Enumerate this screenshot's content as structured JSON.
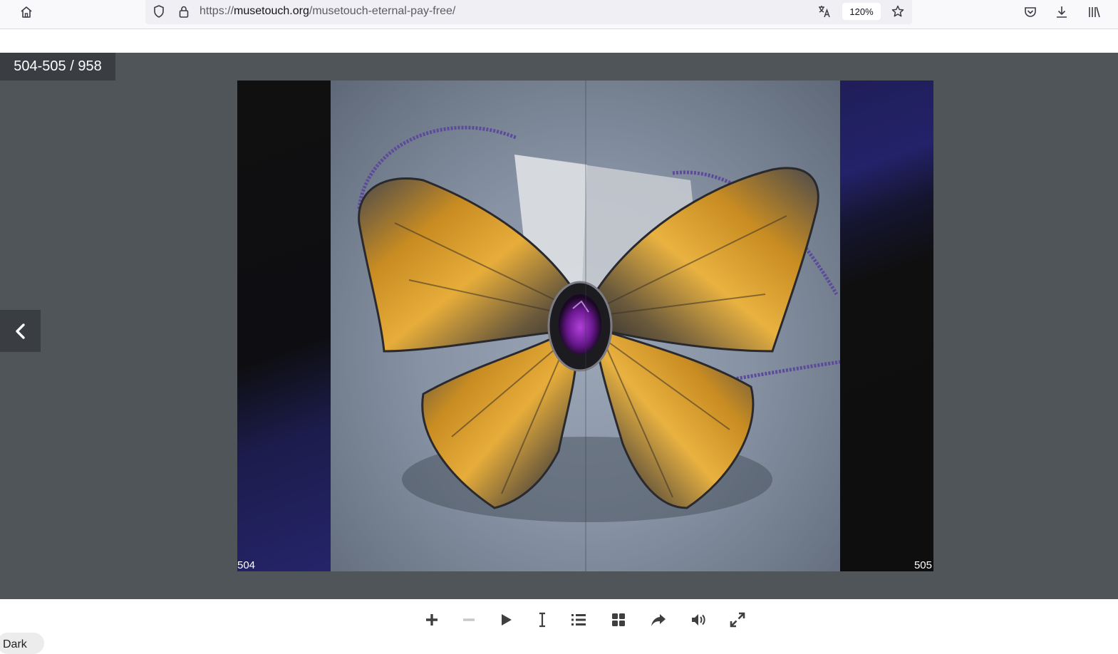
{
  "browser": {
    "url_scheme": "https://",
    "url_host": "musetouch.org",
    "url_path": "/musetouch-eternal-pay-free/",
    "zoom": "120%",
    "icons": [
      "home-icon",
      "shield-icon",
      "lock-icon",
      "translate-icon",
      "star-icon",
      "pocket-icon",
      "download-icon",
      "library-icon"
    ]
  },
  "viewer": {
    "page_counter": "504-505 / 958",
    "left_page_number": "504",
    "right_page_number": "505",
    "background_color": "#50555a"
  },
  "controls": {
    "icons": [
      "zoom-in-icon",
      "zoom-out-icon",
      "play-icon",
      "text-select-icon",
      "table-of-contents-icon",
      "thumbnails-icon",
      "share-icon",
      "sound-icon",
      "fullscreen-icon"
    ],
    "dark_label": "Dark"
  }
}
